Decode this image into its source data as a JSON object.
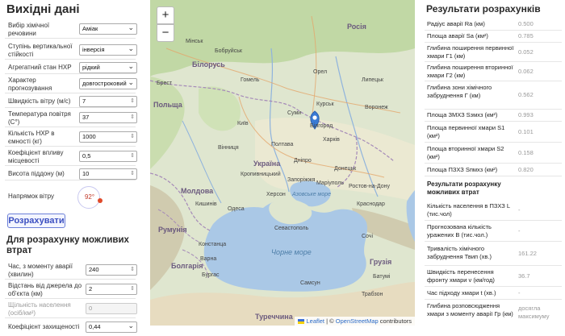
{
  "left": {
    "title": "Вихідні дані",
    "fields": [
      {
        "label": "Вибір хімічної речовини",
        "value": "Аміак",
        "kind": "select"
      },
      {
        "label": "Ступінь вертикальної стійкості",
        "value": "інверсія",
        "kind": "select"
      },
      {
        "label": "Агрегатний стан НХР",
        "value": "рідкий",
        "kind": "select"
      },
      {
        "label": "Характер прогнозування",
        "value": "довгостроковий",
        "kind": "select"
      },
      {
        "label": "Швидкість вітру (м/с)",
        "value": "7",
        "kind": "number"
      },
      {
        "label": "Температура повітря (C°)",
        "value": "37",
        "kind": "number"
      },
      {
        "label": "Кількість НХР в ємності (кг)",
        "value": "1000",
        "kind": "number"
      },
      {
        "label": "Коефіцієнт впливу місцевості",
        "value": "0,5",
        "kind": "number"
      },
      {
        "label": "Висота піддону (м)",
        "value": "10",
        "kind": "number"
      }
    ],
    "wind_label": "Напрямок вітру",
    "wind_value": "92°",
    "calc_button": "Розрахувати",
    "title2": "Для розрахунку можливих втрат",
    "fields2": [
      {
        "label": "Час, з моменту аварії (хвилин)",
        "value": "240",
        "kind": "number"
      },
      {
        "label": "Відстань від джерела до об'єкта (км)",
        "value": "2",
        "kind": "number"
      },
      {
        "label": "Щільність населення (осіб/км²)",
        "value": "0",
        "kind": "disabled"
      },
      {
        "label": "Коефіцієнт захищеності",
        "value": "0,44",
        "kind": "select"
      }
    ]
  },
  "map": {
    "zoom_in": "+",
    "zoom_out": "−",
    "attribution_leaflet": "Leaflet",
    "attribution_sep": " | © ",
    "attribution_osm": "OpenStreetMap",
    "attribution_tail": " contributors",
    "countries": [
      "Білорусь",
      "Росія",
      "Україна",
      "Польща",
      "Молдова",
      "Румунія",
      "Болгарія",
      "Грузія",
      "Туреччина"
    ],
    "cities": [
      "Мінськ",
      "Бобруйськ",
      "Брест",
      "Гомель",
      "Орел",
      "Липецьк",
      "Курськ",
      "Білгород",
      "Суми",
      "Київ",
      "Полтава",
      "Харків",
      "Вінниця",
      "Дніпро",
      "Донецьк",
      "Кропивницький",
      "Запоріжжя",
      "Кишинів",
      "Одеса",
      "Херсон",
      "Маріуполь",
      "Краснодар",
      "Констанца",
      "Варна",
      "Бургас",
      "Севастополь",
      "Самсун",
      "Трабзон",
      "Батумі",
      "Сочі",
      "Ростов-на-Дону",
      "Воронеж"
    ],
    "seas": [
      "Азовське море",
      "Чорне море"
    ]
  },
  "right": {
    "title": "Результати розрахунків",
    "rows": [
      {
        "label": "Радіус аварії Ra (км)",
        "value": "0.500"
      },
      {
        "label": "Площа аварії Sa (км²)",
        "value": "0.785"
      },
      {
        "label": "Глибина поширення первинної хмари Г1 (км)",
        "value": "0.052"
      },
      {
        "label": "Глибина поширення вторинної хмари Г2 (км)",
        "value": "0.062"
      },
      {
        "label": "Глибина зони хімічного забруднення Г (км)",
        "value": "0.562"
      },
      {
        "label": "Площа ЗМХЗ Sзмхз (км²)",
        "value": "0.993"
      },
      {
        "label": "Площа первинної хмари S1 (км²)",
        "value": "0.101"
      },
      {
        "label": "Площа вторинної хмари S2 (км²)",
        "value": "0.158"
      },
      {
        "label": "Площа ПЗХЗ Sпмхз (км²)",
        "value": "0.820"
      }
    ],
    "section": "Результати розрахунку можливих втрат",
    "rows2": [
      {
        "label": "Кількість населення в ПЗХЗ L (тис.чол)",
        "value": "-"
      },
      {
        "label": "Прогнозована кількість уражених В (тис.чол.)",
        "value": "-"
      },
      {
        "label": "Тривалість хімічного забруднення Твип (хв.)",
        "value": "161.22"
      },
      {
        "label": "Швидкість перенесення фронту хмари v (км/год)",
        "value": "36.7"
      },
      {
        "label": "Час підходу хмари t (хв.)",
        "value": "-"
      },
      {
        "label": "Глибина розповсюдження хмари з моменту аварії Гр (км)",
        "value": "досягла максимуму"
      }
    ]
  }
}
